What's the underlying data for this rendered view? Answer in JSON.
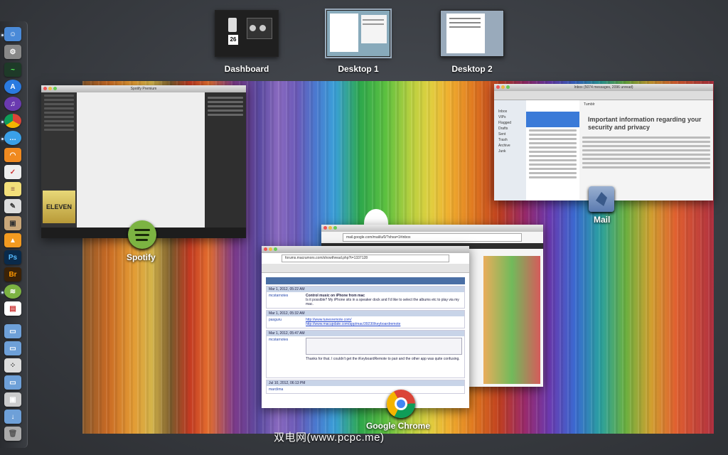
{
  "spaces": [
    {
      "label": "Dashboard",
      "badge": "26"
    },
    {
      "label": "Desktop 1"
    },
    {
      "label": "Desktop 2"
    }
  ],
  "apps": {
    "spotify": {
      "label": "Spotify",
      "title": "Spotify Premium",
      "album": "ELEVEN"
    },
    "mail": {
      "label": "Mail",
      "title": "Inbox (5074 messages, 2096 unread)",
      "heading": "Important information regarding your security and privacy",
      "sender": "Tumblr",
      "folders": [
        "Inbox",
        "VIPs",
        "Flagged",
        "Drafts",
        "Sent",
        "Trash",
        "Archive",
        "Junk"
      ]
    },
    "chrome": {
      "label": "Google Chrome",
      "address1": "forums.macrumors.com/showthread.php?t=1337128",
      "address2": "mail.google.com/mail/u/0/?shva=1#inbox",
      "thread_title": "Control music on iPhone from mac",
      "post1": "Is it possible? My iPhone sits in a speaker dock and I'd like to select the albums etc to play via my mac.",
      "post2_link1": "http://www.tunesremote.com/",
      "post2_link2": "http://www.macupdate.com/app/mac/39230/keyboardremote",
      "post3": "Thanks for that. I couldn't get the iKeyboardRemote to pair and the other app was quite confusing.",
      "date1": "Mar 1, 2012, 05:22 AM",
      "date2": "Mar 1, 2012, 05:32 AM",
      "date3": "Mar 1, 2012, 05:47 AM",
      "date4": "Jul 10, 2012, 06:13 PM",
      "user1": "mcstarnotes",
      "user2": "pasguru",
      "user4": "marclima"
    }
  },
  "watermark": "双电网(www.pcpc.me)"
}
